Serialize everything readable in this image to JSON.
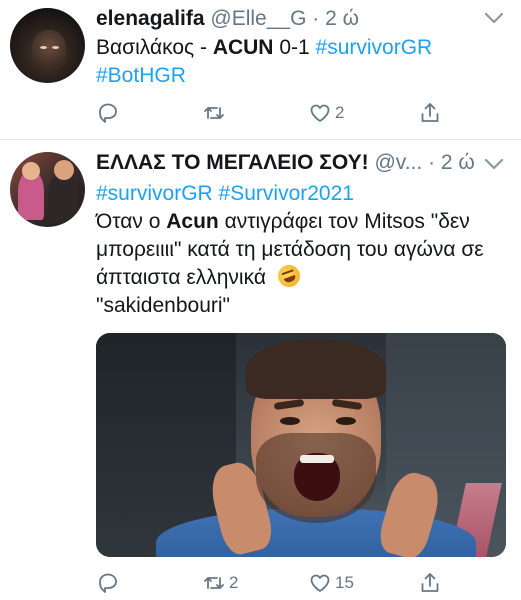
{
  "tweets": [
    {
      "name": "elenagalifa",
      "handle": "@Elle__G",
      "time": "2 ώ",
      "text_parts": [
        "Βασιλάκος - ",
        "ACUN",
        " 0-1 ",
        "#survivorGR",
        "#BotHGR"
      ],
      "reply_count": "",
      "retweet_count": "",
      "like_count": "2"
    },
    {
      "name": "ΕΛΛΑΣ ΤΟ ΜΕΓΑΛΕΙΟ ΣΟΥ!",
      "handle": "@v...",
      "time": "2 ώ",
      "hashtags": [
        "#survivorGR",
        "#Survivor2021"
      ],
      "text_parts": [
        "Όταν ο ",
        "Acun",
        " αντιγράφει τον Mitsos \"δεν μπορειιιι\" κατά τη μετάδοση του αγώνα σε άπταιστα ελληνικά",
        "\"sakidenbouri\""
      ],
      "reply_count": "",
      "retweet_count": "2",
      "like_count": "15"
    }
  ],
  "separator": "·",
  "icons": {
    "caret": "chevron-down-icon",
    "reply": "reply-icon",
    "retweet": "retweet-icon",
    "like": "heart-icon",
    "share": "share-icon",
    "emoji": "rofl-emoji-icon"
  },
  "colors": {
    "hashtag": "#1da1f2",
    "secondary_text": "#657786",
    "divider": "#e1e8ed"
  }
}
